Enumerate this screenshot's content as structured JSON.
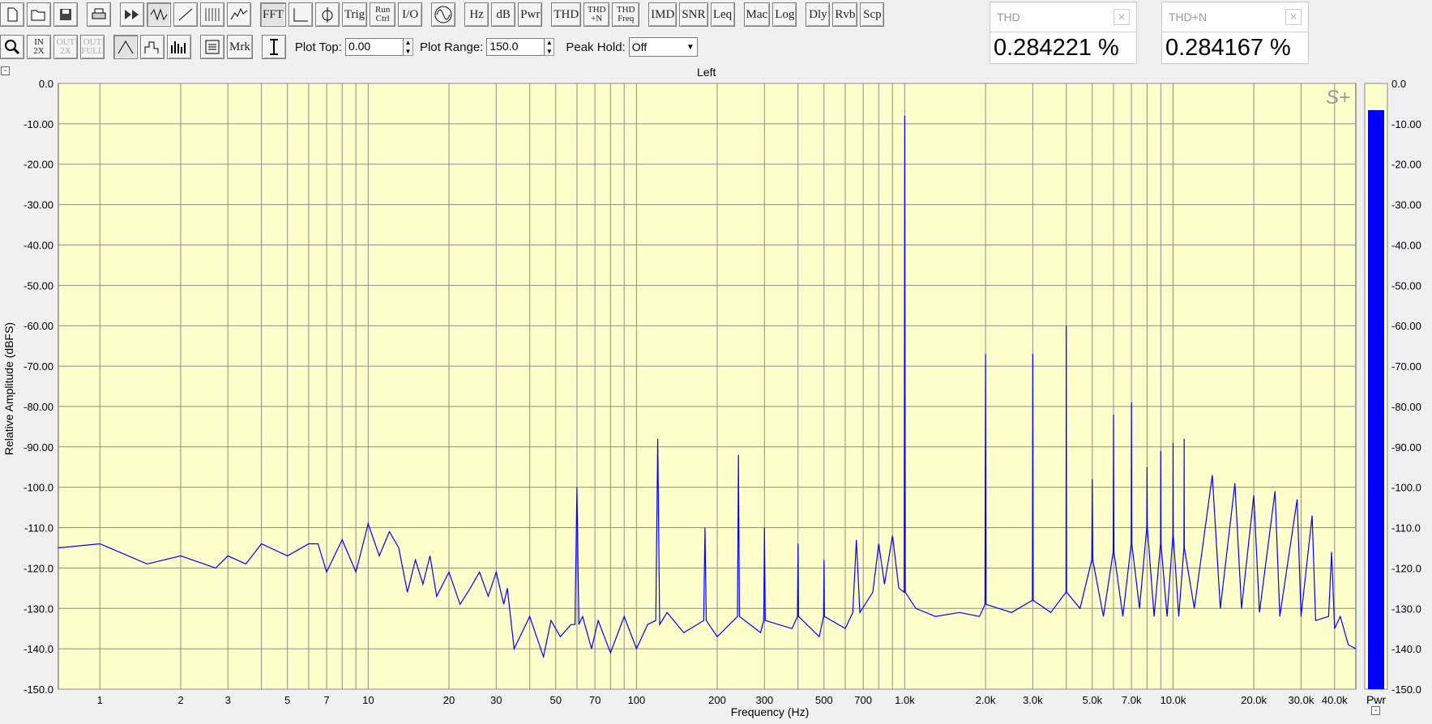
{
  "toolbar_top": {
    "file_buttons": [
      "new-icon",
      "open-icon",
      "save-icon",
      "print-icon"
    ],
    "view_icons": [
      "ffwd-icon",
      "zoom-wave-icon",
      "ramp-icon",
      "spectrogram-icon",
      "waterfall-icon"
    ],
    "fft_label": "FFT",
    "plot_icons": [
      "cursor-icon",
      "scope-icon"
    ],
    "trig_label": "Trig",
    "run_ctrl_label": "Run Ctrl",
    "io_label": "I/O",
    "generator_icon": "sine-wave-icon",
    "hz_label": "Hz",
    "db_label": "dB",
    "pwr_label": "Pwr",
    "thd_label": "THD",
    "thdn_label": "THD +N",
    "thdfreq_label": "THD Freq",
    "imd_label": "IMD",
    "snr_label": "SNR",
    "leq_label": "Leq",
    "mac_label": "Mac",
    "log_label": "Log",
    "dly_label": "Dly",
    "rvb_label": "Rvb",
    "scp_label": "Scp"
  },
  "toolbar_second": {
    "zoom_icon": "magnifier-icon",
    "zoom_in_label": "IN 2X",
    "zoom_out_label": "OUT 2X",
    "zoom_full_label": "OUT FULL",
    "mode_icons": [
      "line-plot-icon",
      "step-plot-icon",
      "bar-plot-icon",
      "average-icon"
    ],
    "mrk_label": "Mrk",
    "cursor_icon": "ibeam-icon",
    "plot_top_label": "Plot Top:",
    "plot_top_value": "0.00",
    "plot_range_label": "Plot Range:",
    "plot_range_value": "150.0",
    "peak_hold_label": "Peak Hold:",
    "peak_hold_value": "Off"
  },
  "meters": [
    {
      "title": "THD",
      "value": "0.284221 %"
    },
    {
      "title": "THD+N",
      "value": "0.284167 %"
    }
  ],
  "channel_title": "Left",
  "logo_text": "S+",
  "pwr_label": "Pwr",
  "colors": {
    "plot_bg": "#ffffcc",
    "trace": "#0000ff",
    "grid": "#8c8c8c",
    "meter_bar": "#0000ff"
  },
  "chart_data": {
    "type": "line",
    "title": "Left",
    "xlabel": "Frequency (Hz)",
    "ylabel": "Relative Amplitude (dBFS)",
    "xscale": "log",
    "xlim": [
      0.7,
      48000
    ],
    "ylim": [
      -150,
      0
    ],
    "grid": true,
    "x_tick_values": [
      1,
      2,
      3,
      5,
      7,
      10,
      20,
      30,
      50,
      70,
      100,
      200,
      300,
      500,
      700,
      1000,
      2000,
      3000,
      5000,
      7000,
      10000,
      20000,
      30000,
      40000
    ],
    "x_tick_labels": [
      "1",
      "2",
      "3",
      "5",
      "7",
      "10",
      "20",
      "30",
      "50",
      "70",
      "100",
      "200",
      "300",
      "500",
      "700",
      "1.0k",
      "2.0k",
      "3.0k",
      "5.0k",
      "7.0k",
      "10.0k",
      "20.0k",
      "30.0k",
      "40.0k"
    ],
    "y_tick_labels": [
      "0.0",
      "-10.00",
      "-20.00",
      "-30.00",
      "-40.00",
      "-50.00",
      "-60.00",
      "-70.00",
      "-80.00",
      "-90.00",
      "-100.0",
      "-110.0",
      "-120.0",
      "-130.0",
      "-140.0",
      "-150.0"
    ],
    "series": [
      {
        "values": [
          [
            0.7,
            -115
          ],
          [
            1,
            -114
          ],
          [
            1.5,
            -119
          ],
          [
            2,
            -117
          ],
          [
            2.7,
            -120
          ],
          [
            3,
            -117
          ],
          [
            3.5,
            -119
          ],
          [
            4,
            -114
          ],
          [
            5,
            -117
          ],
          [
            6,
            -114
          ],
          [
            6.5,
            -114
          ],
          [
            7,
            -121
          ],
          [
            8,
            -113
          ],
          [
            9,
            -121
          ],
          [
            10,
            -109
          ],
          [
            11,
            -117
          ],
          [
            12,
            -111
          ],
          [
            13,
            -115
          ],
          [
            14,
            -126
          ],
          [
            15,
            -118
          ],
          [
            16,
            -124
          ],
          [
            17,
            -117
          ],
          [
            18,
            -127
          ],
          [
            20,
            -121
          ],
          [
            22,
            -129
          ],
          [
            24,
            -125
          ],
          [
            26,
            -121
          ],
          [
            28,
            -127
          ],
          [
            30,
            -121
          ],
          [
            32,
            -129
          ],
          [
            33,
            -125
          ],
          [
            35,
            -140
          ],
          [
            40,
            -132
          ],
          [
            45,
            -142
          ],
          [
            48,
            -133
          ],
          [
            52,
            -137
          ],
          [
            57,
            -134
          ],
          [
            59,
            -134
          ],
          [
            60,
            -100
          ],
          [
            61,
            -134
          ],
          [
            63,
            -132
          ],
          [
            68,
            -140
          ],
          [
            72,
            -133
          ],
          [
            80,
            -141
          ],
          [
            90,
            -132
          ],
          [
            100,
            -140
          ],
          [
            110,
            -134
          ],
          [
            118,
            -133
          ],
          [
            120,
            -88
          ],
          [
            122,
            -134
          ],
          [
            130,
            -131
          ],
          [
            150,
            -136
          ],
          [
            178,
            -133
          ],
          [
            180,
            -110
          ],
          [
            182,
            -133
          ],
          [
            200,
            -137
          ],
          [
            238,
            -132
          ],
          [
            240,
            -92
          ],
          [
            242,
            -132
          ],
          [
            290,
            -136
          ],
          [
            298,
            -133
          ],
          [
            300,
            -110
          ],
          [
            302,
            -133
          ],
          [
            380,
            -135
          ],
          [
            398,
            -132
          ],
          [
            400,
            -114
          ],
          [
            402,
            -132
          ],
          [
            480,
            -137
          ],
          [
            498,
            -132
          ],
          [
            500,
            -118
          ],
          [
            502,
            -132
          ],
          [
            600,
            -135
          ],
          [
            640,
            -131
          ],
          [
            660,
            -113
          ],
          [
            680,
            -131
          ],
          [
            760,
            -126
          ],
          [
            800,
            -114
          ],
          [
            840,
            -124
          ],
          [
            900,
            -112
          ],
          [
            950,
            -125
          ],
          [
            995,
            -126
          ],
          [
            1000,
            -8
          ],
          [
            1005,
            -126
          ],
          [
            1100,
            -130
          ],
          [
            1300,
            -132
          ],
          [
            1600,
            -131
          ],
          [
            1900,
            -132
          ],
          [
            1990,
            -129
          ],
          [
            2000,
            -67
          ],
          [
            2010,
            -129
          ],
          [
            2500,
            -131
          ],
          [
            2990,
            -128
          ],
          [
            3000,
            -67
          ],
          [
            3010,
            -128
          ],
          [
            3500,
            -131
          ],
          [
            3990,
            -126
          ],
          [
            4000,
            -60
          ],
          [
            4010,
            -126
          ],
          [
            4500,
            -130
          ],
          [
            4980,
            -118
          ],
          [
            5000,
            -98
          ],
          [
            5020,
            -118
          ],
          [
            5500,
            -132
          ],
          [
            5980,
            -116
          ],
          [
            6000,
            -82
          ],
          [
            6020,
            -116
          ],
          [
            6500,
            -132
          ],
          [
            6980,
            -114
          ],
          [
            7000,
            -79
          ],
          [
            7020,
            -114
          ],
          [
            7500,
            -130
          ],
          [
            7980,
            -110
          ],
          [
            8000,
            -95
          ],
          [
            8020,
            -110
          ],
          [
            8500,
            -132
          ],
          [
            8980,
            -114
          ],
          [
            9000,
            -91
          ],
          [
            9020,
            -114
          ],
          [
            9500,
            -132
          ],
          [
            9980,
            -112
          ],
          [
            10000,
            -89
          ],
          [
            10020,
            -112
          ],
          [
            10500,
            -132
          ],
          [
            10980,
            -115
          ],
          [
            11000,
            -88
          ],
          [
            11020,
            -115
          ],
          [
            12000,
            -130
          ],
          [
            14000,
            -97
          ],
          [
            15000,
            -130
          ],
          [
            17000,
            -99
          ],
          [
            18000,
            -130
          ],
          [
            20000,
            -102
          ],
          [
            21000,
            -131
          ],
          [
            24000,
            -101
          ],
          [
            25000,
            -132
          ],
          [
            29000,
            -103
          ],
          [
            30000,
            -132
          ],
          [
            33000,
            -107
          ],
          [
            34000,
            -133
          ],
          [
            38000,
            -132
          ],
          [
            39000,
            -116
          ],
          [
            40000,
            -135
          ],
          [
            42000,
            -132
          ],
          [
            45000,
            -139
          ],
          [
            48000,
            -140
          ]
        ]
      }
    ]
  }
}
